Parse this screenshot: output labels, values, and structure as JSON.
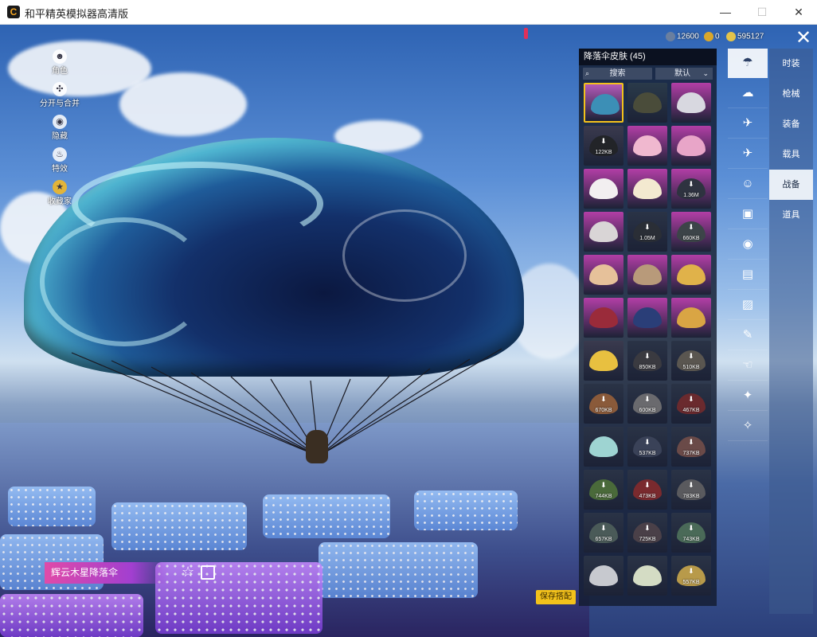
{
  "window": {
    "title": "和平精英模拟器高清版",
    "icon": "C",
    "minimize": "—",
    "maximize": "☐",
    "close": "✕"
  },
  "currency": [
    {
      "name": "coin-a-icon",
      "value": "12600",
      "color": "#6a7f9f"
    },
    {
      "name": "coin-b-icon",
      "value": "0",
      "color": "#d9a72b"
    },
    {
      "name": "coin-c-icon",
      "value": "595127",
      "color": "#e3c34a"
    }
  ],
  "left_tools": [
    {
      "icon": "person-icon",
      "label": "角色"
    },
    {
      "icon": "split-icon",
      "label": "分开与合并"
    },
    {
      "icon": "eye-icon",
      "label": "隐藏"
    },
    {
      "icon": "fire-icon",
      "label": "特效"
    },
    {
      "icon": "collection-icon",
      "label": "收藏家"
    }
  ],
  "panel": {
    "title": "降落伞皮肤 (45)",
    "search_placeholder": "搜索",
    "sort_label": "默认"
  },
  "grid_items": [
    {
      "size": "",
      "color": "#3c8fb6",
      "accent": "#b25ab8",
      "selected": true,
      "download": false
    },
    {
      "size": "",
      "color": "#4a4c3a",
      "accent": "#2a3a4a",
      "selected": false,
      "download": false
    },
    {
      "size": "",
      "color": "#d8d8e0",
      "accent": "#b23ea6",
      "selected": false,
      "download": false
    },
    {
      "size": "122KB",
      "color": "#222428",
      "accent": "#3a3a4e",
      "selected": false,
      "download": true
    },
    {
      "size": "",
      "color": "#f0b8cf",
      "accent": "#b23ea6",
      "selected": false,
      "download": false
    },
    {
      "size": "",
      "color": "#e8a5c8",
      "accent": "#b23ea6",
      "selected": false,
      "download": false
    },
    {
      "size": "",
      "color": "#f2eff0",
      "accent": "#b23ea6",
      "selected": false,
      "download": false
    },
    {
      "size": "",
      "color": "#f3e9d0",
      "accent": "#b23ea6",
      "selected": false,
      "download": false
    },
    {
      "size": "1.36M",
      "color": "#2e3340",
      "accent": "#b23ea6",
      "selected": false,
      "download": true
    },
    {
      "size": "",
      "color": "#d9d5d6",
      "accent": "#b23ea6",
      "selected": false,
      "download": false
    },
    {
      "size": "1.05M",
      "color": "#2a2e36",
      "accent": "#2a3346",
      "selected": false,
      "download": true
    },
    {
      "size": "660KB",
      "color": "#3c4448",
      "accent": "#b23ea6",
      "selected": false,
      "download": true
    },
    {
      "size": "",
      "color": "#e6c19a",
      "accent": "#b23ea6",
      "selected": false,
      "download": false
    },
    {
      "size": "",
      "color": "#b89a7a",
      "accent": "#b23ea6",
      "selected": false,
      "download": false
    },
    {
      "size": "",
      "color": "#e0b24a",
      "accent": "#b23ea6",
      "selected": false,
      "download": false
    },
    {
      "size": "",
      "color": "#9a2b3a",
      "accent": "#b23ea6",
      "selected": false,
      "download": false
    },
    {
      "size": "",
      "color": "#2a3e78",
      "accent": "#b23ea6",
      "selected": false,
      "download": false
    },
    {
      "size": "",
      "color": "#d9a544",
      "accent": "#b23ea6",
      "selected": false,
      "download": false
    },
    {
      "size": "",
      "color": "#e8c040",
      "accent": "#3a3a4e",
      "selected": false,
      "download": false
    },
    {
      "size": "850KB",
      "color": "#3a3a40",
      "accent": "#2a3346",
      "selected": false,
      "download": true
    },
    {
      "size": "510KB",
      "color": "#5a5650",
      "accent": "#2a3346",
      "selected": false,
      "download": true
    },
    {
      "size": "670KB",
      "color": "#8a5a3a",
      "accent": "#2a3346",
      "selected": false,
      "download": true
    },
    {
      "size": "600KB",
      "color": "#6a6a6e",
      "accent": "#2a3346",
      "selected": false,
      "download": true
    },
    {
      "size": "467KB",
      "color": "#6a2a2e",
      "accent": "#2a3346",
      "selected": false,
      "download": true
    },
    {
      "size": "",
      "color": "#9ed4d2",
      "accent": "#2a3346",
      "selected": false,
      "download": false
    },
    {
      "size": "537KB",
      "color": "#3a4258",
      "accent": "#2a3346",
      "selected": false,
      "download": true
    },
    {
      "size": "737KB",
      "color": "#6a4a48",
      "accent": "#2a3346",
      "selected": false,
      "download": true
    },
    {
      "size": "744KB",
      "color": "#4a6a3a",
      "accent": "#2a3346",
      "selected": false,
      "download": true
    },
    {
      "size": "473KB",
      "color": "#7a2a2e",
      "accent": "#2a3346",
      "selected": false,
      "download": true
    },
    {
      "size": "783KB",
      "color": "#5a5a5e",
      "accent": "#2a3346",
      "selected": false,
      "download": true
    },
    {
      "size": "657KB",
      "color": "#4a5a58",
      "accent": "#2a3346",
      "selected": false,
      "download": true
    },
    {
      "size": "725KB",
      "color": "#4a4048",
      "accent": "#2a3346",
      "selected": false,
      "download": true
    },
    {
      "size": "743KB",
      "color": "#4a6a58",
      "accent": "#2a3346",
      "selected": false,
      "download": true
    },
    {
      "size": "",
      "color": "#c7c9cf",
      "accent": "#2a3346",
      "selected": false,
      "download": false
    },
    {
      "size": "",
      "color": "#d4dcc4",
      "accent": "#2a3346",
      "selected": false,
      "download": false
    },
    {
      "size": "557KB",
      "color": "#b89a4a",
      "accent": "#2a3346",
      "selected": false,
      "download": true
    }
  ],
  "sub_rail": [
    {
      "icon": "parachute-icon",
      "glyph": "☂",
      "active": true
    },
    {
      "icon": "cloud-icon",
      "glyph": "☁",
      "active": false
    },
    {
      "icon": "drone-icon",
      "glyph": "✈",
      "active": false
    },
    {
      "icon": "plane-icon",
      "glyph": "✈",
      "active": false
    },
    {
      "icon": "smile-icon",
      "glyph": "☺",
      "active": false
    },
    {
      "icon": "robot-icon",
      "glyph": "▣",
      "active": false
    },
    {
      "icon": "signal-icon",
      "glyph": "◉",
      "active": false
    },
    {
      "icon": "board-icon",
      "glyph": "▤",
      "active": false
    },
    {
      "icon": "picture-icon",
      "glyph": "▨",
      "active": false
    },
    {
      "icon": "spray-icon",
      "glyph": "✎",
      "active": false
    },
    {
      "icon": "hand-icon",
      "glyph": "☜",
      "active": false
    },
    {
      "icon": "sparkle-icon",
      "glyph": "✦",
      "active": false
    },
    {
      "icon": "bird-icon",
      "glyph": "✧",
      "active": false
    }
  ],
  "tabs": [
    {
      "label": "时装",
      "active": false
    },
    {
      "label": "枪械",
      "active": false
    },
    {
      "label": "装备",
      "active": false
    },
    {
      "label": "载具",
      "active": false
    },
    {
      "label": "战备",
      "active": true
    },
    {
      "label": "道具",
      "active": false
    }
  ],
  "footer": {
    "skin_name": "辉云木星降落伞",
    "star": "☆",
    "save_button": "保存搭配"
  }
}
